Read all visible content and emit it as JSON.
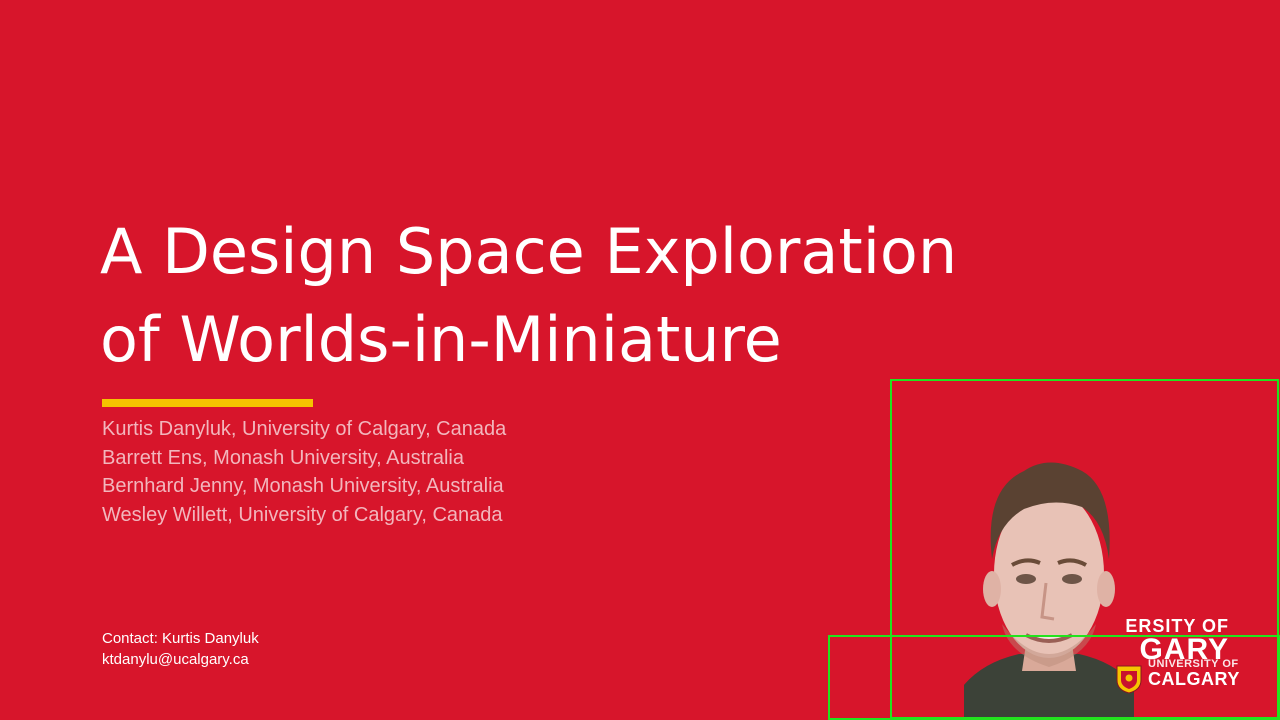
{
  "slide": {
    "title_lines": [
      "A Design Space Exploration",
      "of Worlds-in-Miniature"
    ],
    "authors": [
      "Kurtis Danyluk, University of Calgary, Canada",
      "Barrett Ens, Monash University, Australia",
      "Bernhard Jenny, Monash University, Australia",
      "Wesley Willett, University of Calgary, Canada"
    ],
    "contact": {
      "name_line": "Contact: Kurtis Danyluk",
      "email": "ktdanylu@ucalgary.ca"
    }
  },
  "webcam": {
    "logo_line1": "ERSITY OF",
    "logo_line2": "GARY"
  },
  "logo": {
    "line1": "UNIVERSITY OF",
    "line2": "CALGARY",
    "crest_icon": "university-crest-icon"
  },
  "colors": {
    "background": "#d7152b",
    "accent": "#f5c400",
    "highlight_box": "#22e31e",
    "author_text": "#f2b6bd"
  }
}
